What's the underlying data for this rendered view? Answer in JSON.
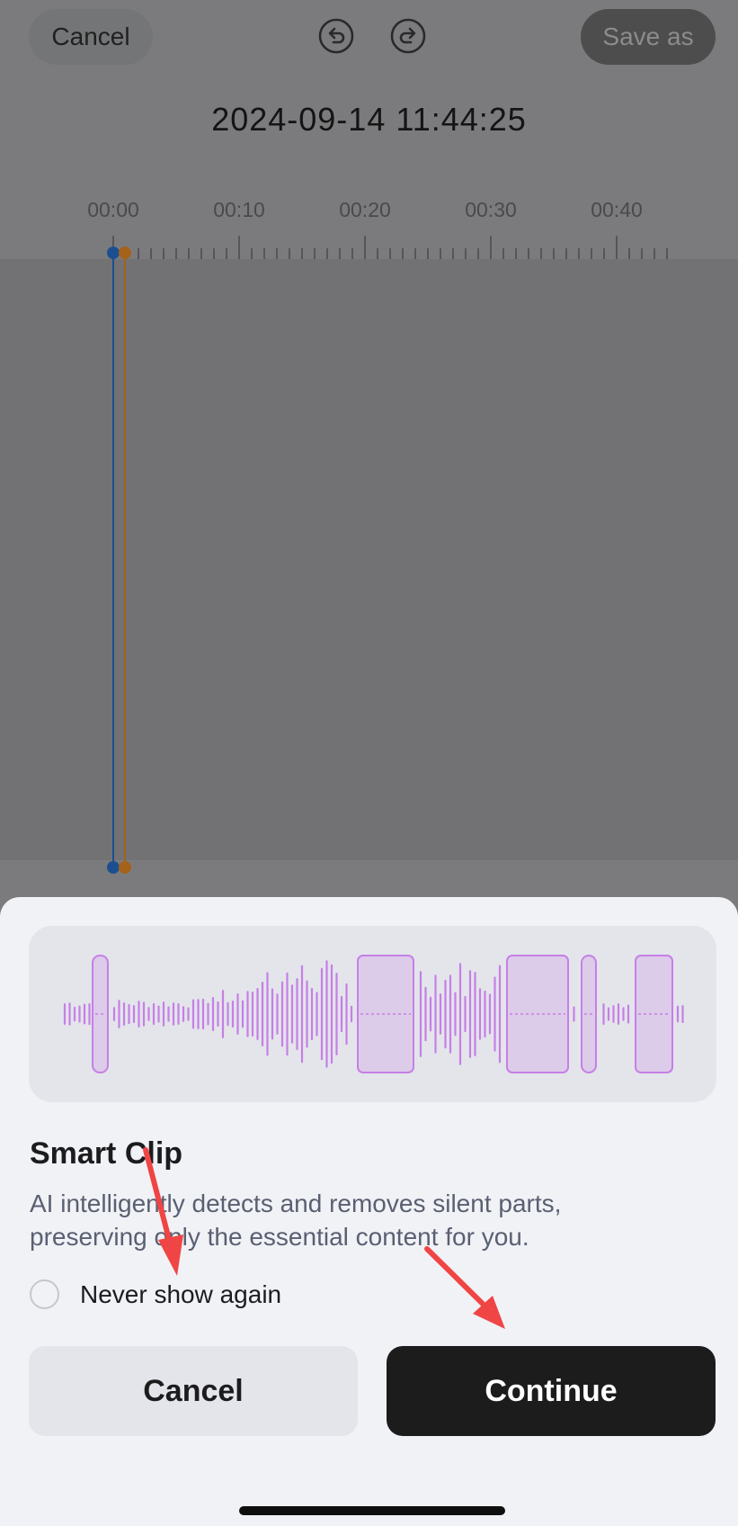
{
  "editor": {
    "cancel_label": "Cancel",
    "save_label": "Save as",
    "recording_title": "2024-09-14 11:44:25",
    "ruler_labels": [
      "00:00",
      "00:10",
      "00:20",
      "00:30",
      "00:40"
    ],
    "icons": [
      "undo-icon",
      "redo-icon"
    ]
  },
  "dialog": {
    "title": "Smart Clip",
    "description": "AI intelligently detects and removes silent parts, preserving only the essential content for you.",
    "never_show_label": "Never show again",
    "never_show_checked": false,
    "cancel_label": "Cancel",
    "continue_label": "Continue"
  },
  "colors": {
    "waveform": "#c77fe6",
    "clip_fill": "#dccbe9",
    "playhead_blue": "#1c4f8f",
    "playhead_orange": "#a4621a",
    "annotation_arrow": "#f04545"
  }
}
